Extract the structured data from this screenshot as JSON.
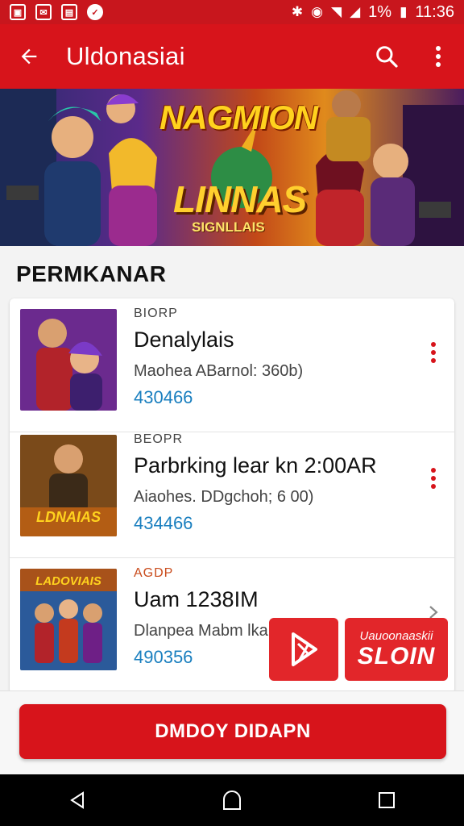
{
  "status_bar": {
    "battery": "1%",
    "time": "11:36"
  },
  "app_bar": {
    "title": "Uldonasiai"
  },
  "banner": {
    "title": "NAGMION",
    "logo": "LINNAS",
    "logo_sub": "SIGNLLAIS"
  },
  "section": {
    "title": "PERMKANAR"
  },
  "items": [
    {
      "tag": "BIORP",
      "title": "Denalylais",
      "meta": "Maohea ABarnol: 360b)",
      "price": "430466",
      "action_icon": "more-vertical-icon"
    },
    {
      "tag": "BEOPR",
      "title": "Parbrking lear kn 2:00AR",
      "meta": "Aiaohes. DDgchoh; 6 00)",
      "price": "434466",
      "action_icon": "more-vertical-icon"
    },
    {
      "tag": "AGDP",
      "title": "Uam 1238IM",
      "meta": "Dlanpea Mabm lka",
      "price": "490356",
      "action_icon": "chevron-right-icon"
    }
  ],
  "ad": {
    "join_top": "Uauoonaaskii",
    "join_main": "SLOIN"
  },
  "cta": {
    "label": "DMDOY DIDAPN"
  },
  "colors": {
    "primary": "#d7141b",
    "status_bar": "#c8161d",
    "price": "#1a7fbf"
  }
}
